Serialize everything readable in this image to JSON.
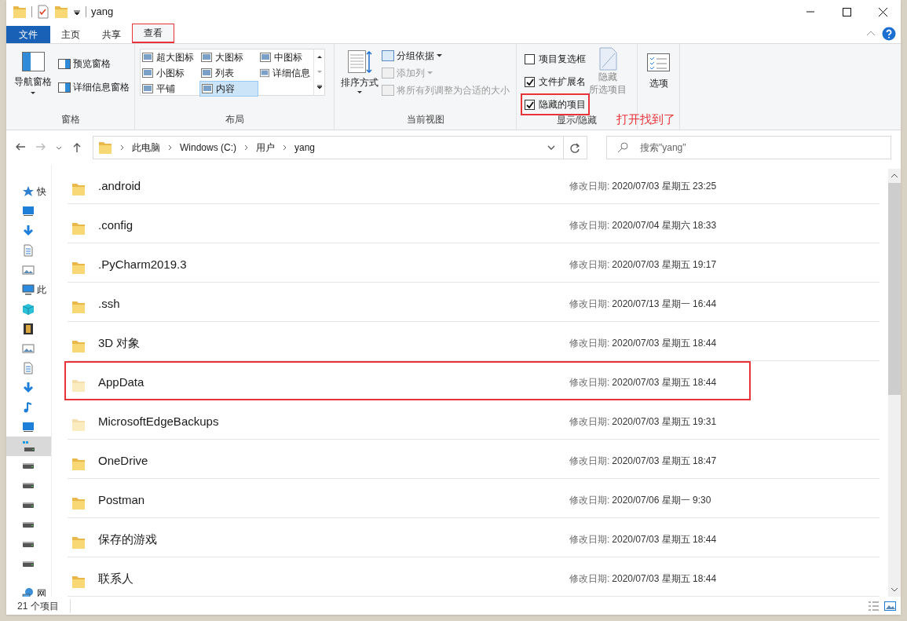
{
  "window": {
    "title": "yang"
  },
  "tabs": [
    {
      "label": "文件",
      "kind": "file",
      "selected": false,
      "highlighted": false
    },
    {
      "label": "主页",
      "kind": "tab",
      "selected": false,
      "highlighted": false
    },
    {
      "label": "共享",
      "kind": "tab",
      "selected": false,
      "highlighted": false
    },
    {
      "label": "查看",
      "kind": "tab",
      "selected": true,
      "highlighted": true
    }
  ],
  "ribbon": {
    "panes": {
      "label": "窗格",
      "nav_pane": "导航窗格",
      "items": [
        "预览窗格",
        "详细信息窗格"
      ]
    },
    "layout": {
      "label": "布局",
      "items": [
        {
          "label": "超大图标",
          "selected": false
        },
        {
          "label": "大图标",
          "selected": false
        },
        {
          "label": "中图标",
          "selected": false
        },
        {
          "label": "小图标",
          "selected": false
        },
        {
          "label": "列表",
          "selected": false
        },
        {
          "label": "详细信息",
          "selected": false
        },
        {
          "label": "平铺",
          "selected": false
        },
        {
          "label": "内容",
          "selected": true
        }
      ]
    },
    "current_view": {
      "label": "当前视图",
      "sort": "排序方式",
      "items": [
        {
          "label": "分组依据",
          "disabled": false,
          "dropdown": true
        },
        {
          "label": "添加列",
          "disabled": true,
          "dropdown": true
        },
        {
          "label": "将所有列调整为合适的大小",
          "disabled": true,
          "dropdown": false
        }
      ]
    },
    "show_hide": {
      "label": "显示/隐藏",
      "checkboxes": [
        {
          "label": "项目复选框",
          "checked": false,
          "highlighted": false
        },
        {
          "label": "文件扩展名",
          "checked": true,
          "highlighted": false
        },
        {
          "label": "隐藏的项目",
          "checked": true,
          "highlighted": true
        }
      ],
      "hide_selected": {
        "label_lines": [
          "隐藏",
          "所选项目"
        ],
        "disabled": true
      }
    },
    "options": {
      "label": "选项"
    }
  },
  "annotation": "打开找到了",
  "address": {
    "crumbs": [
      "此电脑",
      "Windows (C:)",
      "用户",
      "yang"
    ],
    "search_placeholder": "搜索\"yang\""
  },
  "nav_pane": [
    {
      "label": "快",
      "kind": "star",
      "selected": false
    },
    {
      "kind": "desktop",
      "selected": false
    },
    {
      "kind": "download",
      "selected": false
    },
    {
      "kind": "doc",
      "selected": false
    },
    {
      "kind": "image",
      "selected": false
    },
    {
      "label": "此",
      "kind": "pc",
      "selected": false
    },
    {
      "kind": "cube",
      "selected": false
    },
    {
      "kind": "film",
      "selected": false
    },
    {
      "kind": "image",
      "selected": false
    },
    {
      "kind": "doc",
      "selected": false
    },
    {
      "kind": "download",
      "selected": false
    },
    {
      "kind": "music",
      "selected": false
    },
    {
      "kind": "desktop",
      "selected": false
    },
    {
      "kind": "windrive",
      "selected": true
    },
    {
      "kind": "drive",
      "selected": false
    },
    {
      "kind": "drive",
      "selected": false
    },
    {
      "kind": "drive",
      "selected": false
    },
    {
      "kind": "drive",
      "selected": false
    },
    {
      "kind": "drive",
      "selected": false
    },
    {
      "kind": "drive",
      "selected": false
    },
    {
      "label": "网",
      "kind": "network",
      "selected": false
    }
  ],
  "files": [
    {
      "name": ".android",
      "date_label": "修改日期:",
      "date": "2020/07/03 星期五 23:25",
      "hidden": false,
      "highlighted": false
    },
    {
      "name": ".config",
      "date_label": "修改日期:",
      "date": "2020/07/04 星期六 18:33",
      "hidden": false,
      "highlighted": false
    },
    {
      "name": ".PyCharm2019.3",
      "date_label": "修改日期:",
      "date": "2020/07/03 星期五 19:17",
      "hidden": false,
      "highlighted": false
    },
    {
      "name": ".ssh",
      "date_label": "修改日期:",
      "date": "2020/07/13 星期一 16:44",
      "hidden": false,
      "highlighted": false
    },
    {
      "name": "3D 对象",
      "date_label": "修改日期:",
      "date": "2020/07/03 星期五 18:44",
      "hidden": false,
      "highlighted": false
    },
    {
      "name": "AppData",
      "date_label": "修改日期:",
      "date": "2020/07/03 星期五 18:44",
      "hidden": true,
      "highlighted": true
    },
    {
      "name": "MicrosoftEdgeBackups",
      "date_label": "修改日期:",
      "date": "2020/07/03 星期五 19:31",
      "hidden": true,
      "highlighted": false
    },
    {
      "name": "OneDrive",
      "date_label": "修改日期:",
      "date": "2020/07/03 星期五 18:47",
      "hidden": false,
      "highlighted": false
    },
    {
      "name": "Postman",
      "date_label": "修改日期:",
      "date": "2020/07/06 星期一 9:30",
      "hidden": false,
      "highlighted": false
    },
    {
      "name": "保存的游戏",
      "date_label": "修改日期:",
      "date": "2020/07/03 星期五 18:44",
      "hidden": false,
      "highlighted": false
    },
    {
      "name": "联系人",
      "date_label": "修改日期:",
      "date": "2020/07/03 星期五 18:44",
      "hidden": false,
      "highlighted": false
    }
  ],
  "status_bar": {
    "count": "21 个项目"
  }
}
